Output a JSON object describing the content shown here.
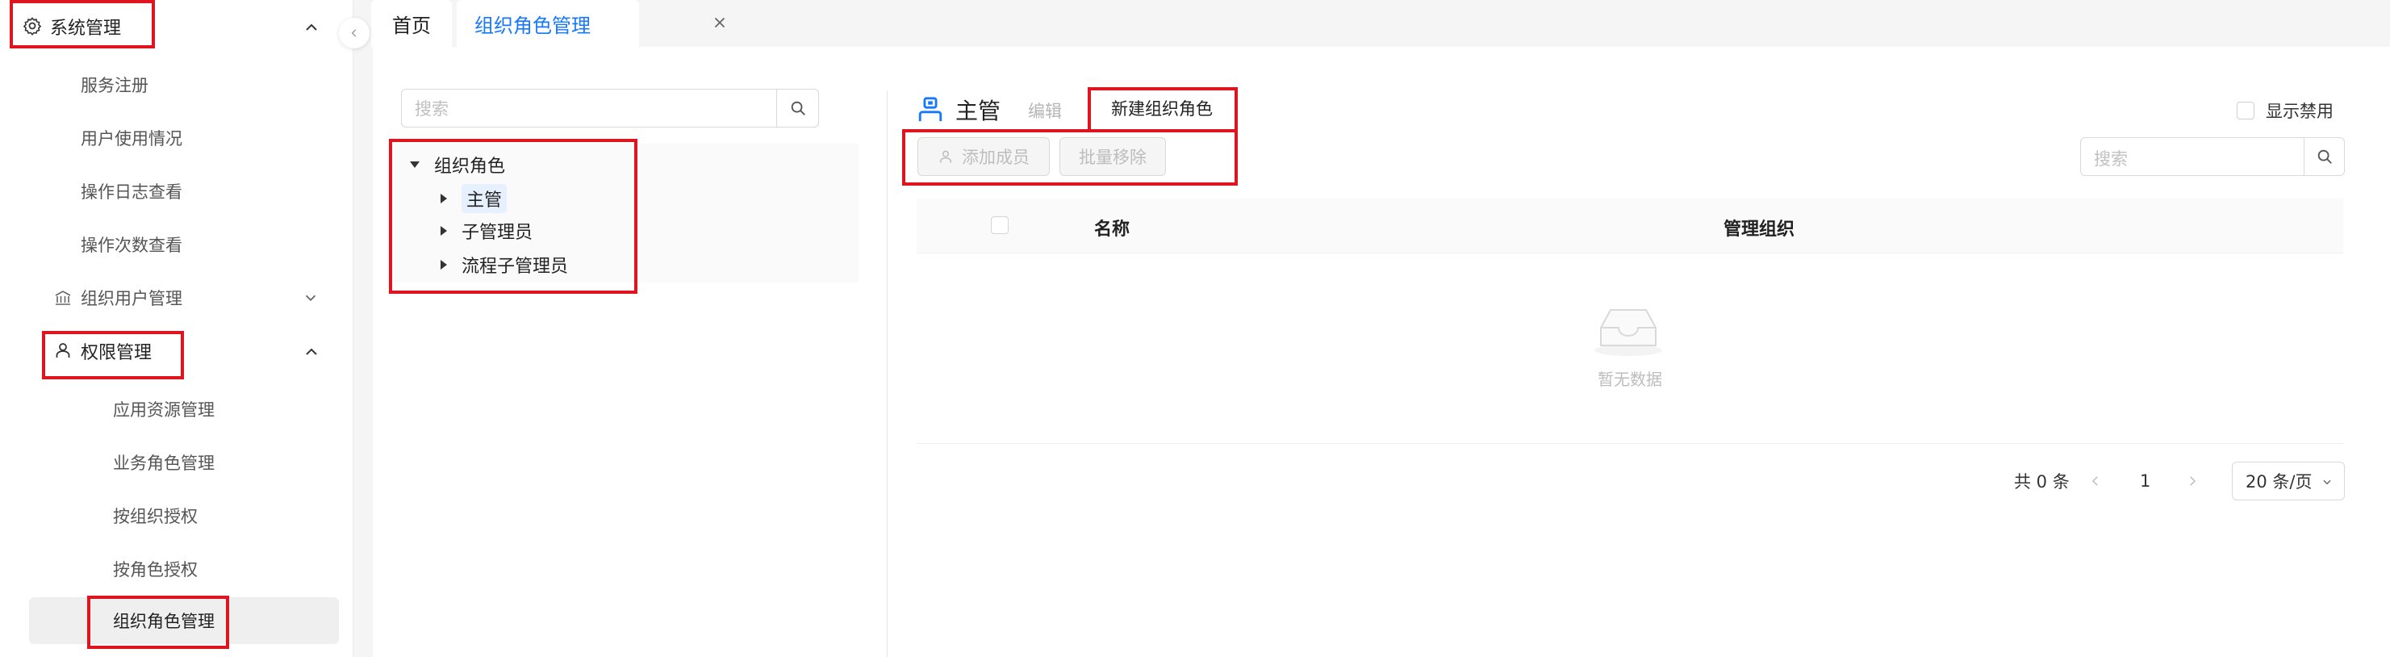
{
  "sidebar": {
    "system_mgmt": "系统管理",
    "items": [
      {
        "label": "服务注册"
      },
      {
        "label": "用户使用情况"
      },
      {
        "label": "操作日志查看"
      },
      {
        "label": "操作次数查看"
      }
    ],
    "org_user_mgmt": "组织用户管理",
    "perm_mgmt": "权限管理",
    "perm_items": [
      {
        "label": "应用资源管理"
      },
      {
        "label": "业务角色管理"
      },
      {
        "label": "按组织授权"
      },
      {
        "label": "按角色授权"
      },
      {
        "label": "组织角色管理"
      }
    ]
  },
  "tabs": {
    "home": "首页",
    "active": "组织角色管理"
  },
  "left_panel": {
    "search_placeholder": "搜索",
    "tree": {
      "root": "组织角色",
      "children": [
        {
          "label": "主管"
        },
        {
          "label": "子管理员"
        },
        {
          "label": "流程子管理员"
        }
      ]
    }
  },
  "right_panel": {
    "title": "主管",
    "edit": "编辑",
    "new_role": "新建组织角色",
    "add_member": "添加成员",
    "batch_remove": "批量移除",
    "show_disabled": "显示禁用",
    "search_placeholder": "搜索",
    "table": {
      "col_name": "名称",
      "col_org": "管理组织",
      "empty": "暂无数据"
    },
    "pager": {
      "total": "共 0 条",
      "page": "1",
      "size": "20 条/页"
    }
  },
  "colors": {
    "accent": "#1677ff",
    "highlight_border": "#e0141e"
  },
  "icons": [
    "gear-icon",
    "chevron-up-icon",
    "chevron-down-icon",
    "bank-icon",
    "user-icon",
    "close-icon",
    "search-icon",
    "empty-inbox-icon",
    "chevron-left-icon",
    "chevron-right-icon"
  ]
}
